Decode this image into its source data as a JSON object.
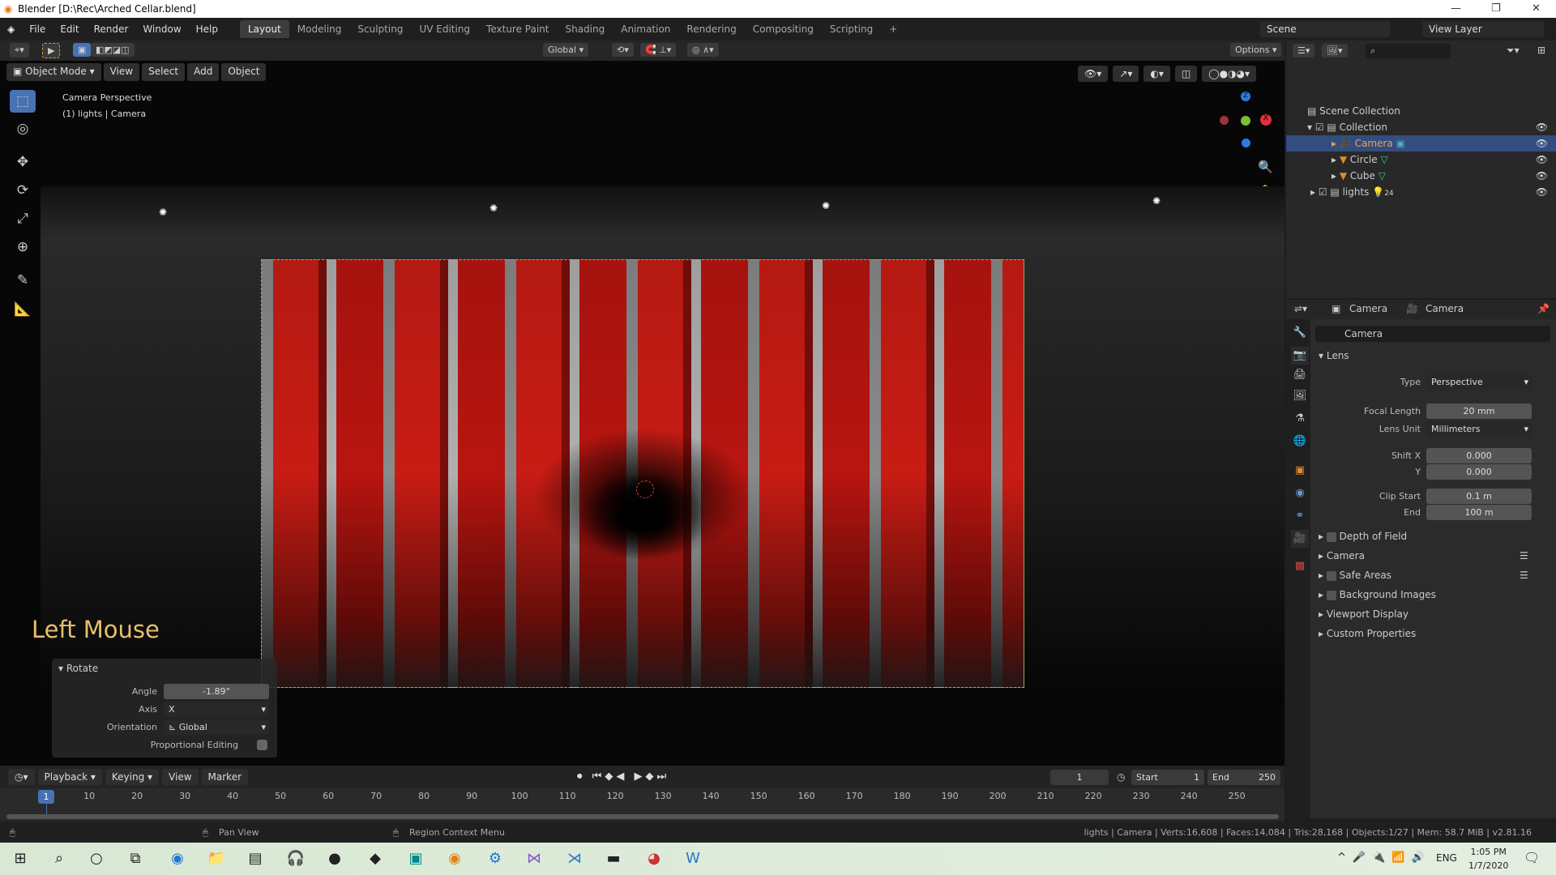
{
  "window": {
    "title": "Blender [D:\\Rec\\Arched Cellar.blend]",
    "min": "—",
    "max": "❐",
    "close": "✕"
  },
  "menu": {
    "items": [
      "File",
      "Edit",
      "Render",
      "Window",
      "Help"
    ],
    "workspaces": [
      "Layout",
      "Modeling",
      "Sculpting",
      "UV Editing",
      "Texture Paint",
      "Shading",
      "Animation",
      "Rendering",
      "Compositing",
      "Scripting"
    ],
    "add": "+",
    "active_workspace": "Layout",
    "scene": "Scene",
    "view_layer": "View Layer"
  },
  "toolheader": {
    "orientation": "Global",
    "options": "Options"
  },
  "viewport": {
    "mode": "Object Mode",
    "menus": [
      "View",
      "Select",
      "Add",
      "Object"
    ],
    "info1": "Camera Perspective",
    "info2": "(1) lights | Camera",
    "gizmo": {
      "x": "X",
      "y": "Y",
      "z": "Z"
    }
  },
  "operator": {
    "key_hint": "Left Mouse",
    "panel_title": "Rotate",
    "angle_label": "Angle",
    "angle": "-1.89°",
    "axis_label": "Axis",
    "axis": "X",
    "orientation_label": "Orientation",
    "orientation": "Global",
    "proportional_label": "Proportional Editing"
  },
  "outliner": {
    "root": "Scene Collection",
    "items": [
      {
        "name": "Collection",
        "level": 0
      },
      {
        "name": "Camera",
        "level": 1,
        "selected": true
      },
      {
        "name": "Circle",
        "level": 1
      },
      {
        "name": "Cube",
        "level": 1
      },
      {
        "name": "lights",
        "level": 0,
        "badge": "24"
      }
    ]
  },
  "properties": {
    "breadcrumb1": "Camera",
    "breadcrumb2": "Camera",
    "datablock": "Camera",
    "lens_panel": "Lens",
    "type_label": "Type",
    "type": "Perspective",
    "focal_label": "Focal Length",
    "focal": "20 mm",
    "unit_label": "Lens Unit",
    "unit": "Millimeters",
    "shiftx_label": "Shift X",
    "shiftx": "0.000",
    "shifty_label": "Y",
    "shifty": "0.000",
    "clipstart_label": "Clip Start",
    "clipstart": "0.1 m",
    "clipend_label": "End",
    "clipend": "100 m",
    "panels": [
      "Depth of Field",
      "Camera",
      "Safe Areas",
      "Background Images",
      "Viewport Display",
      "Custom Properties"
    ]
  },
  "timeline": {
    "menus": [
      "Playback",
      "Keying",
      "View",
      "Marker"
    ],
    "current_frame": "1",
    "start_label": "Start",
    "start": "1",
    "end_label": "End",
    "end": "250",
    "ticks": [
      "10",
      "20",
      "30",
      "40",
      "50",
      "60",
      "70",
      "80",
      "90",
      "100",
      "110",
      "120",
      "130",
      "140",
      "150",
      "160",
      "170",
      "180",
      "190",
      "200",
      "210",
      "220",
      "230",
      "240",
      "250"
    ]
  },
  "status": {
    "left": "Pan View",
    "mid": "Region Context Menu",
    "right": "lights | Camera | Verts:16,608 | Faces:14,084 | Tris:28,168 | Objects:1/27 | Mem: 58.7 MiB | v2.81.16"
  },
  "taskbar": {
    "lang": "ENG",
    "time": "1:05 PM",
    "date": "1/7/2020"
  },
  "colors": {
    "accent": "#4772b3",
    "selected_row": "#334d80",
    "camera_frame": "#c9a23a",
    "key_hint": "#e8c06a"
  }
}
